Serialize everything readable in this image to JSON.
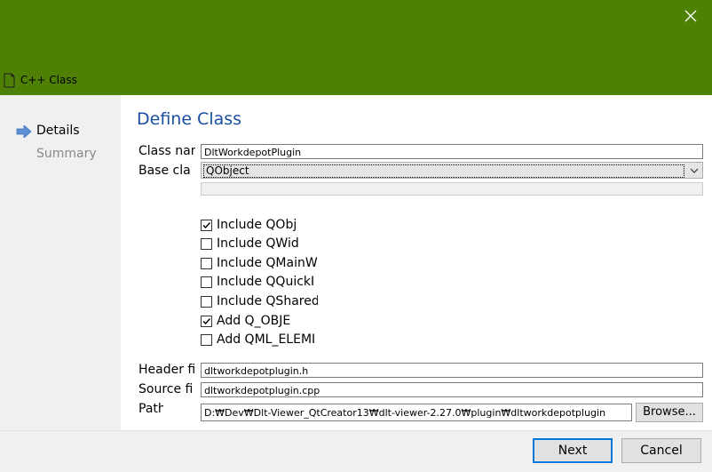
{
  "window": {
    "title": "C++ Class",
    "accent_color": "#4e8006"
  },
  "sidebar": {
    "items": [
      {
        "label": "Details",
        "active": true
      },
      {
        "label": "Summary",
        "active": false
      }
    ]
  },
  "page": {
    "heading": "Define Class"
  },
  "form": {
    "class_name": {
      "label": "Class nam",
      "value": "DltWorkdepotPlugin"
    },
    "base_class": {
      "label": "Base cla",
      "value": "QObject"
    },
    "checkboxes": [
      {
        "label": "Include QObj",
        "checked": true
      },
      {
        "label": "Include QWid",
        "checked": false
      },
      {
        "label": "Include QMainWin",
        "checked": false
      },
      {
        "label": "Include QQuickI",
        "checked": false
      },
      {
        "label": "Include QShared[",
        "checked": false
      },
      {
        "label": "Add Q_OBJE",
        "checked": true
      },
      {
        "label": "Add QML_ELEMI",
        "checked": false
      }
    ],
    "header_file": {
      "label": "Header fi",
      "value": "dltworkdepotplugin.h"
    },
    "source_file": {
      "label": "Source fi",
      "value": "dltworkdepotplugin.cpp"
    },
    "path": {
      "label": "Path",
      "value": "D:₩Dev₩Dlt-Viewer_QtCreator13₩dlt-viewer-2.27.0₩plugin₩dltworkdepotplugin"
    },
    "browse_label": "Browse..."
  },
  "buttons": {
    "next": "Next",
    "cancel": "Cancel"
  },
  "icons": {
    "close": "close-icon",
    "file": "file-icon",
    "arrow": "arrow-right-icon",
    "dropdown": "chevron-down-icon",
    "check": "checkmark-icon"
  }
}
